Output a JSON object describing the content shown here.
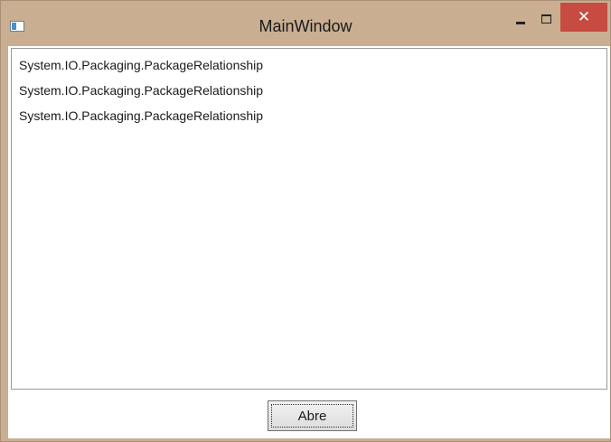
{
  "window": {
    "title": "MainWindow",
    "minimize_glyph": "minimize-icon",
    "maximize_glyph": "maximize-icon",
    "close_label": "✕"
  },
  "list": {
    "items": [
      {
        "text": "System.IO.Packaging.PackageRelationship"
      },
      {
        "text": "System.IO.Packaging.PackageRelationship"
      },
      {
        "text": "System.IO.Packaging.PackageRelationship"
      }
    ]
  },
  "footer": {
    "open_button_label": "Abre"
  },
  "colors": {
    "frame": "#c9ae92",
    "close_button": "#c74b40"
  }
}
